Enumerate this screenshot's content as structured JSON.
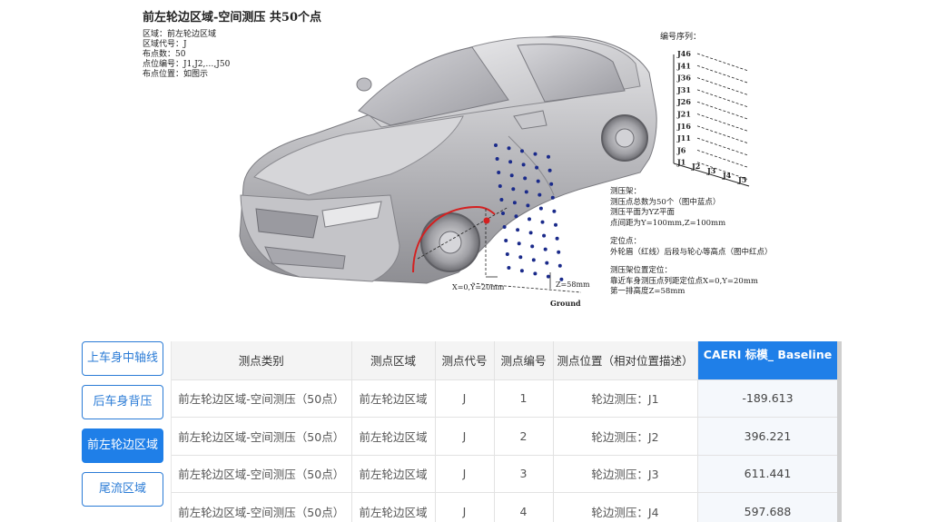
{
  "figure": {
    "title": "前左轮边区域-空间测压 共50个点",
    "info": [
      "区域：前左轮边区域",
      "区域代号：J",
      "布点数：50",
      "点位编号：J1,J2,…,J50",
      "布点位置：如图示"
    ],
    "sequence_title": "编号序列：",
    "sequence_rows": [
      "J46",
      "J41",
      "J36",
      "J31",
      "J26",
      "J21",
      "J16",
      "J11",
      "J6",
      "J1"
    ],
    "sequence_cols": [
      "J2",
      "J3",
      "J4",
      "J5"
    ],
    "notes": [
      "测压架：",
      "测压点总数为50个（图中蓝点）",
      "测压平面为YZ平面",
      "点间距为Y=100mm,Z=100mm",
      "",
      "定位点：",
      "外轮眉（红线）后段与轮心等高点（图中红点）",
      "",
      "测压架位置定位：",
      "靠近车身测压点列距定位点X=0,Y=20mm",
      "第一排高度Z=58mm"
    ],
    "dim_xy": "X=0,Y=20mm",
    "dim_z": "Z=58mm",
    "ground_label": "Ground"
  },
  "nav": {
    "items": [
      {
        "label": "上车身中轴线",
        "active": false
      },
      {
        "label": "后车身背压",
        "active": false
      },
      {
        "label": "前左轮边区域",
        "active": true
      },
      {
        "label": "尾流区域",
        "active": false
      }
    ]
  },
  "table": {
    "headers": [
      "测点类别",
      "测点区域",
      "测点代号",
      "测点编号",
      "测点位置（相对位置描述）",
      "CAERI 标模_ Baseline"
    ],
    "rows": [
      [
        "前左轮边区域-空间测压（50点）",
        "前左轮边区域",
        "J",
        "1",
        "轮边测压：J1",
        "-189.613"
      ],
      [
        "前左轮边区域-空间测压（50点）",
        "前左轮边区域",
        "J",
        "2",
        "轮边测压：J2",
        "396.221"
      ],
      [
        "前左轮边区域-空间测压（50点）",
        "前左轮边区域",
        "J",
        "3",
        "轮边测压：J3",
        "611.441"
      ],
      [
        "前左轮边区域-空间测压（50点）",
        "前左轮边区域",
        "J",
        "4",
        "轮边测压：J4",
        "597.688"
      ]
    ]
  },
  "colors": {
    "accent": "#1f7fe8",
    "probe_dots": "#1a2a8a",
    "wheel_arch_line": "#d42020"
  }
}
